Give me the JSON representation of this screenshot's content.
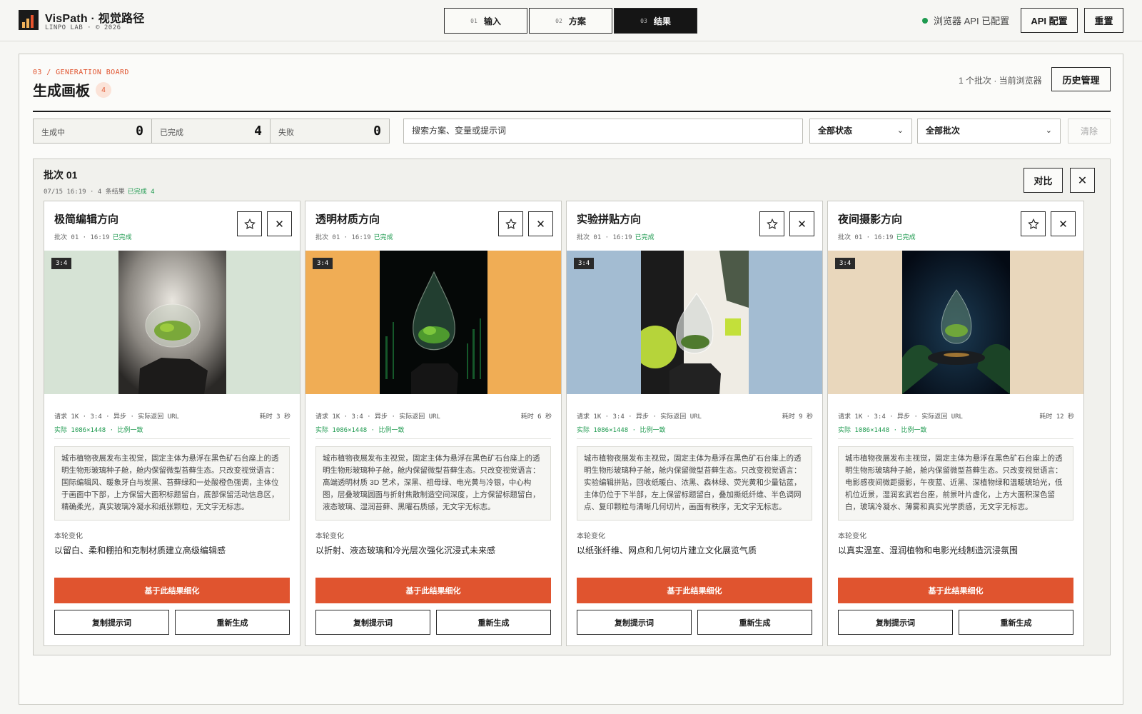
{
  "header": {
    "title": "VisPath · 视觉路径",
    "subtitle": "LINPO LAB · © 2026",
    "steps": [
      {
        "num": "01",
        "label": "输入"
      },
      {
        "num": "02",
        "label": "方案"
      },
      {
        "num": "03",
        "label": "结果"
      }
    ],
    "active_step": "03",
    "api_status": "浏览器 API 已配置",
    "api_config_label": "API 配置",
    "reset_label": "重置",
    "status_color": "#1e9a4f"
  },
  "board": {
    "tag": "03 / GENERATION BOARD",
    "title": "生成画板",
    "count": "4",
    "meta": "1 个批次 · 当前浏览器",
    "history_label": "历史管理",
    "accent_color": "#e0542f",
    "stats": [
      {
        "label": "生成中",
        "value": "0"
      },
      {
        "label": "已完成",
        "value": "4"
      },
      {
        "label": "失败",
        "value": "0"
      }
    ],
    "search_placeholder": "搜索方案、变量或提示词",
    "filter_status": "全部状态",
    "filter_batch": "全部批次",
    "clear_label": "清除"
  },
  "batch": {
    "title": "批次 01",
    "meta": "07/15 16:19 · 4 条结果",
    "done": "已完成 4",
    "compare_label": "对比",
    "cards": [
      {
        "title": "极简编辑方向",
        "meta": "批次 01 · 16:19",
        "status": "已完成",
        "ratio": "3:4",
        "request": "请求 1K · 3:4 · 异步 · 实际返回 URL",
        "duration": "耗时 3 秒",
        "actual": "实际 1086×1448 · 比例一致",
        "prompt": "城市植物夜展发布主视觉，固定主体为悬浮在黑色矿石台座上的透明生物形玻璃种子舱，舱内保留微型苔藓生态。只改变视觉语言：国际编辑风、暖象牙白与炭黑、苔藓绿和一处酸橙色强调，主体位于画面中下部，上方保留大面积标题留白，底部保留活动信息区，精确柔光，真实玻璃冷凝水和纸张颗粒，无文字无标志。",
        "change_label": "本轮变化",
        "change": "以留白、柔和棚拍和克制材质建立高级编辑感",
        "refine_label": "基于此结果细化",
        "copy_label": "复制提示词",
        "regen_label": "重新生成",
        "bg_color": "#d6e3d5"
      },
      {
        "title": "透明材质方向",
        "meta": "批次 01 · 16:19",
        "status": "已完成",
        "ratio": "3:4",
        "request": "请求 1K · 3:4 · 异步 · 实际返回 URL",
        "duration": "耗时 6 秒",
        "actual": "实际 1086×1448 · 比例一致",
        "prompt": "城市植物夜展发布主视觉，固定主体为悬浮在黑色矿石台座上的透明生物形玻璃种子舱，舱内保留微型苔藓生态。只改变视觉语言：高端透明材质 3D 艺术，深黑、祖母绿、电光黄与冷银，中心构图，层叠玻璃圆面与折射焦散制造空间深度，上方保留标题留白，液态玻璃、湿润苔藓、黑曜石质感，无文字无标志。",
        "change_label": "本轮变化",
        "change": "以折射、液态玻璃和冷光层次强化沉浸式未来感",
        "refine_label": "基于此结果细化",
        "copy_label": "复制提示词",
        "regen_label": "重新生成",
        "bg_color": "#f0ad55"
      },
      {
        "title": "实验拼贴方向",
        "meta": "批次 01 · 16:19",
        "status": "已完成",
        "ratio": "3:4",
        "request": "请求 1K · 3:4 · 异步 · 实际返回 URL",
        "duration": "耗时 9 秒",
        "actual": "实际 1086×1448 · 比例一致",
        "prompt": "城市植物夜展发布主视觉，固定主体为悬浮在黑色矿石台座上的透明生物形玻璃种子舱，舱内保留微型苔藓生态。只改变视觉语言：实验编辑拼贴，回收纸暖白、浓黑、森林绿、荧光黄和少量钴蓝，主体仍位于下半部，左上保留标题留白，叠加撕纸纤维、半色调网点、复印颗粒与清晰几何切片，画面有秩序，无文字无标志。",
        "change_label": "本轮变化",
        "change": "以纸张纤维、网点和几何切片建立文化展览气质",
        "refine_label": "基于此结果细化",
        "copy_label": "复制提示词",
        "regen_label": "重新生成",
        "bg_color": "#a3bcd2"
      },
      {
        "title": "夜间摄影方向",
        "meta": "批次 01 · 16:19",
        "status": "已完成",
        "ratio": "3:4",
        "request": "请求 1K · 3:4 · 异步 · 实际返回 URL",
        "duration": "耗时 12 秒",
        "actual": "实际 1086×1448 · 比例一致",
        "prompt": "城市植物夜展发布主视觉，固定主体为悬浮在黑色矿石台座上的透明生物形玻璃种子舱，舱内保留微型苔藓生态。只改变视觉语言：电影感夜间微距摄影，午夜蓝、近黑、深植物绿和温暖琥珀光，低机位近景，湿润玄武岩台座，前景叶片虚化，上方大面积深色留白，玻璃冷凝水、薄雾和真实光学质感，无文字无标志。",
        "change_label": "本轮变化",
        "change": "以真实温室、湿润植物和电影光线制造沉浸氛围",
        "refine_label": "基于此结果细化",
        "copy_label": "复制提示词",
        "regen_label": "重新生成",
        "bg_color": "#e9d7bc"
      }
    ]
  }
}
